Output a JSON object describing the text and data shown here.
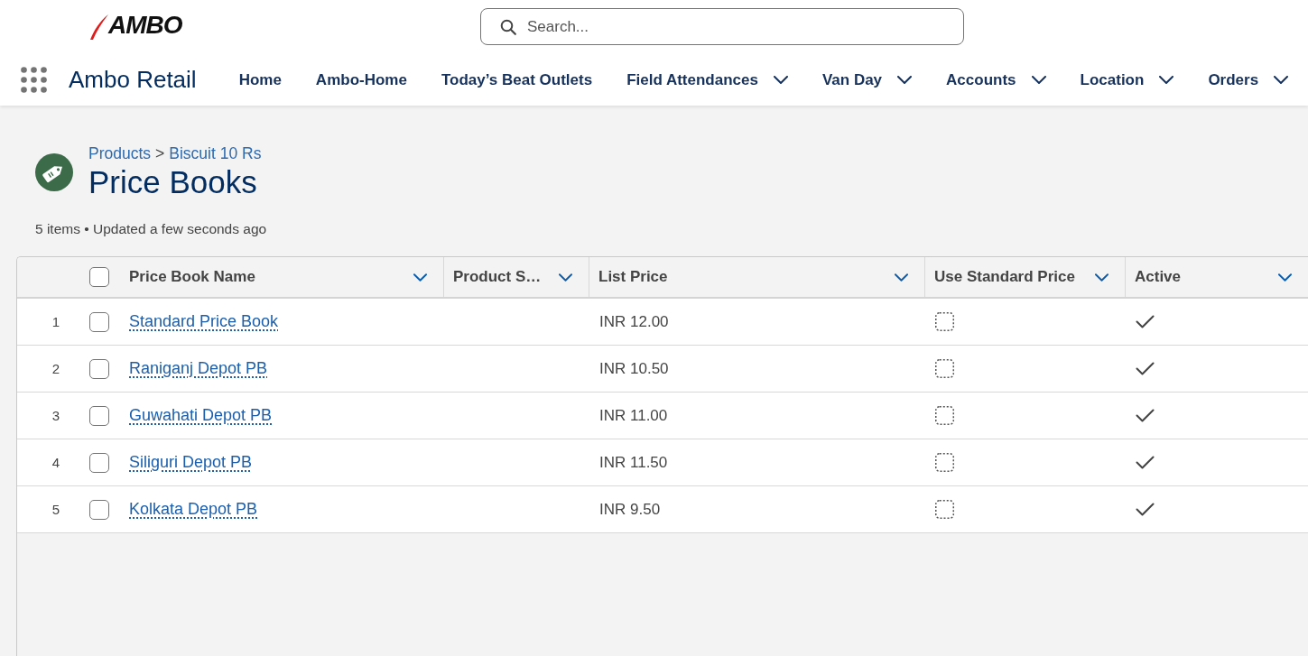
{
  "header": {
    "logo": "AMBO",
    "search": {
      "placeholder": "Search..."
    }
  },
  "nav": {
    "app_name": "Ambo Retail",
    "items": [
      {
        "label": "Home",
        "dropdown": false
      },
      {
        "label": "Ambo-Home",
        "dropdown": false
      },
      {
        "label": "Today’s Beat Outlets",
        "dropdown": false
      },
      {
        "label": "Field Attendances",
        "dropdown": true
      },
      {
        "label": "Van Day",
        "dropdown": true
      },
      {
        "label": "Accounts",
        "dropdown": true
      },
      {
        "label": "Location",
        "dropdown": true
      },
      {
        "label": "Orders",
        "dropdown": true
      }
    ]
  },
  "page": {
    "breadcrumb": {
      "items": [
        "Products",
        "Biscuit 10 Rs"
      ],
      "separator": ">"
    },
    "title": "Price Books",
    "summary": "5 items • Updated a few seconds ago"
  },
  "table": {
    "select_all": {
      "checked": false
    },
    "columns": [
      {
        "label": "Price Book Name"
      },
      {
        "label": "Product S…"
      },
      {
        "label": "List Price"
      },
      {
        "label": "Use Standard Price"
      },
      {
        "label": "Active"
      }
    ],
    "rows": [
      {
        "number": "1",
        "selected": false,
        "name": "Standard Price Book",
        "list_price": "INR 12.00",
        "use_standard_price": false,
        "active": true
      },
      {
        "number": "2",
        "selected": false,
        "name": "Raniganj Depot PB",
        "list_price": "INR 10.50",
        "use_standard_price": false,
        "active": true
      },
      {
        "number": "3",
        "selected": false,
        "name": "Guwahati Depot PB",
        "list_price": "INR 11.00",
        "use_standard_price": false,
        "active": true
      },
      {
        "number": "4",
        "selected": false,
        "name": "Siliguri Depot PB",
        "list_price": "INR 11.50",
        "use_standard_price": false,
        "active": true
      },
      {
        "number": "5",
        "selected": false,
        "name": "Kolkata Depot PB",
        "list_price": "INR 9.50",
        "use_standard_price": false,
        "active": true
      }
    ]
  }
}
